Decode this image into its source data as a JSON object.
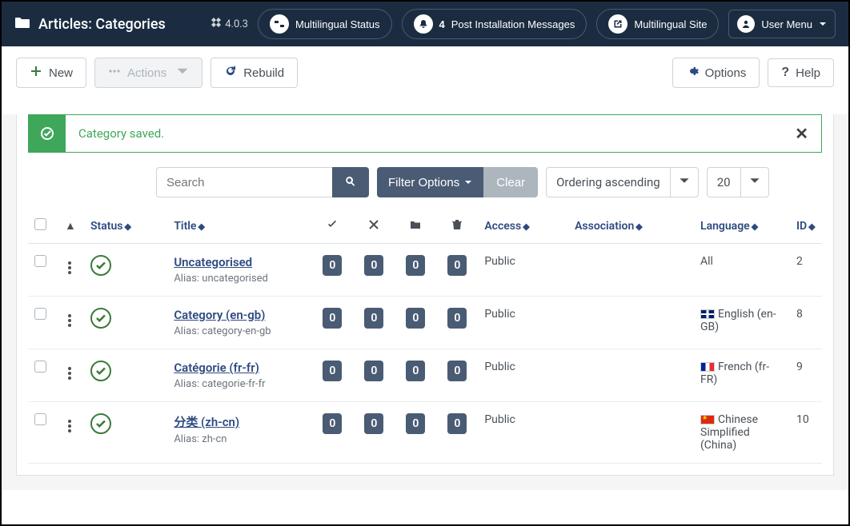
{
  "header": {
    "title": "Articles: Categories",
    "version": "4.0.3",
    "buttons": {
      "multilingual_status": "Multilingual Status",
      "post_install": "Post Installation Messages",
      "post_install_count": "4",
      "multilingual_site": "Multilingual Site",
      "user_menu": "User Menu"
    }
  },
  "toolbar": {
    "new": "New",
    "actions": "Actions",
    "rebuild": "Rebuild",
    "options": "Options",
    "help": "Help"
  },
  "alert": {
    "message": "Category saved."
  },
  "filters": {
    "search_placeholder": "Search",
    "filter_options": "Filter Options",
    "clear": "Clear",
    "ordering": "Ordering ascending",
    "limit": "20"
  },
  "columns": {
    "status": "Status",
    "title": "Title",
    "access": "Access",
    "association": "Association",
    "language": "Language",
    "id": "ID"
  },
  "rows": [
    {
      "title": "Uncategorised",
      "alias_prefix": "Alias: ",
      "alias": "uncategorised",
      "c1": "0",
      "c2": "0",
      "c3": "0",
      "c4": "0",
      "access": "Public",
      "language": "All",
      "flag": "",
      "id": "2"
    },
    {
      "title": "Category (en-gb)",
      "alias_prefix": "Alias: ",
      "alias": "category-en-gb",
      "c1": "0",
      "c2": "0",
      "c3": "0",
      "c4": "0",
      "access": "Public",
      "language": "English (en-GB)",
      "flag": "gb",
      "id": "8"
    },
    {
      "title": "Catégorie (fr-fr)",
      "alias_prefix": "Alias: ",
      "alias": "categorie-fr-fr",
      "c1": "0",
      "c2": "0",
      "c3": "0",
      "c4": "0",
      "access": "Public",
      "language": "French (fr-FR)",
      "flag": "fr",
      "id": "9"
    },
    {
      "title": "分类 (zh-cn)",
      "alias_prefix": "Alias: ",
      "alias": "zh-cn",
      "c1": "0",
      "c2": "0",
      "c3": "0",
      "c4": "0",
      "access": "Public",
      "language": "Chinese Simplified (China)",
      "flag": "cn",
      "id": "10"
    }
  ]
}
